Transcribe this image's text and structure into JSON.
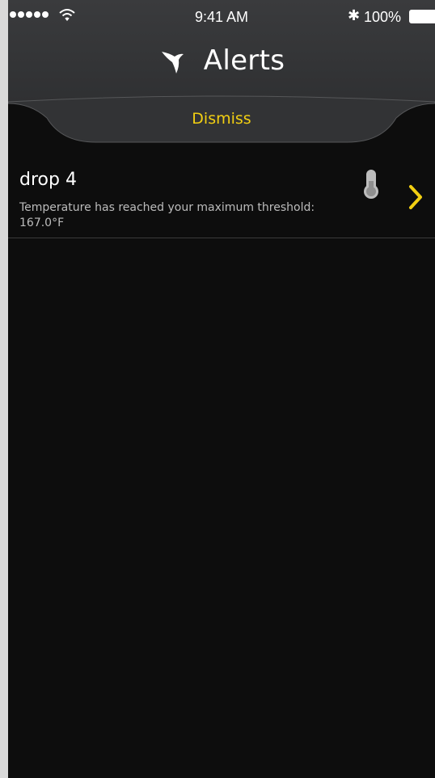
{
  "status_bar": {
    "time": "9:41 AM",
    "bluetooth_icon": "bluetooth-icon",
    "battery": "100%"
  },
  "header": {
    "title": "Alerts",
    "logo_icon": "swift-bird-icon"
  },
  "dismiss": {
    "label": "Dismiss"
  },
  "alerts": [
    {
      "name": "drop 4",
      "message": "Temperature has reached your maximum threshold: 167.0°F",
      "icon": "thermometer-icon"
    }
  ],
  "colors": {
    "accent": "#f2cf12",
    "header_bg": "#3a3b3d",
    "body_bg": "#0d0d0d"
  }
}
